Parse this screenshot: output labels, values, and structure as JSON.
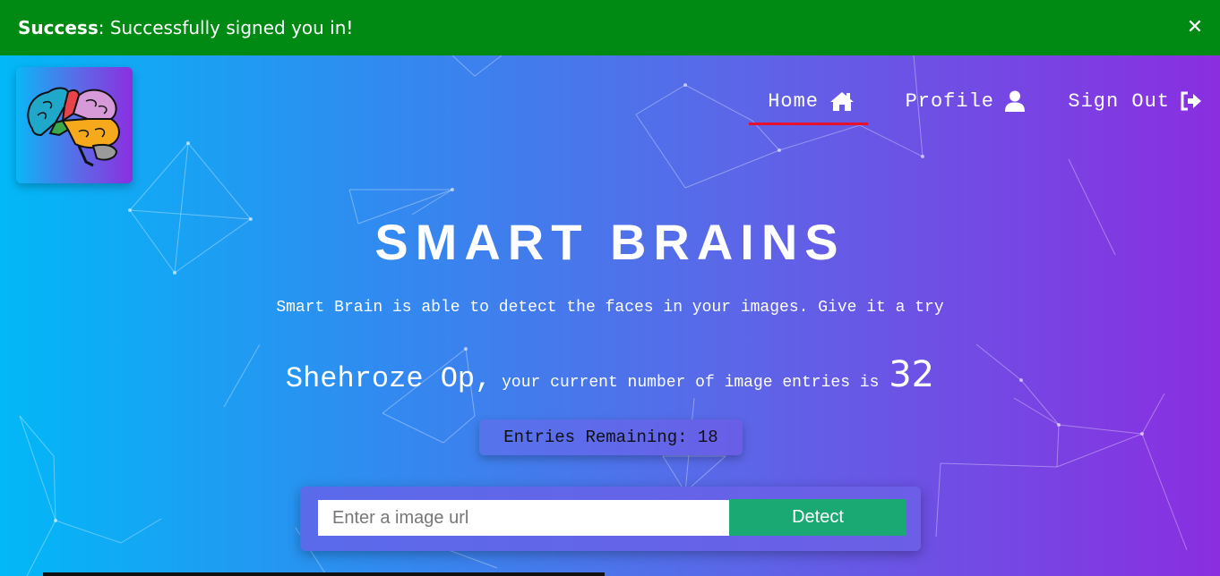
{
  "toast": {
    "label": "Success",
    "message": ": Successfully signed you in!",
    "close_icon": "close-icon",
    "bg_color": "#008a13"
  },
  "logo": {
    "icon": "brain-logo-icon"
  },
  "nav": {
    "home": "Home",
    "profile": "Profile",
    "signout": "Sign Out",
    "home_icon": "home-icon",
    "profile_icon": "user-icon",
    "signout_icon": "sign-out-icon",
    "active_underline_color": "#e8112d"
  },
  "hero": {
    "title": "SMART BRAINS",
    "subtitle": "Smart Brain is able to detect the faces in your images. Give it a try"
  },
  "user": {
    "name": "Shehroze Op,",
    "entries_text": " your current number of image entries is ",
    "entries_count": "32"
  },
  "entries_remaining": {
    "label": "Entries Remaining: 18"
  },
  "form": {
    "placeholder": "Enter a image url",
    "value": "",
    "detect_label": "Detect",
    "detect_color": "#1aa873"
  }
}
